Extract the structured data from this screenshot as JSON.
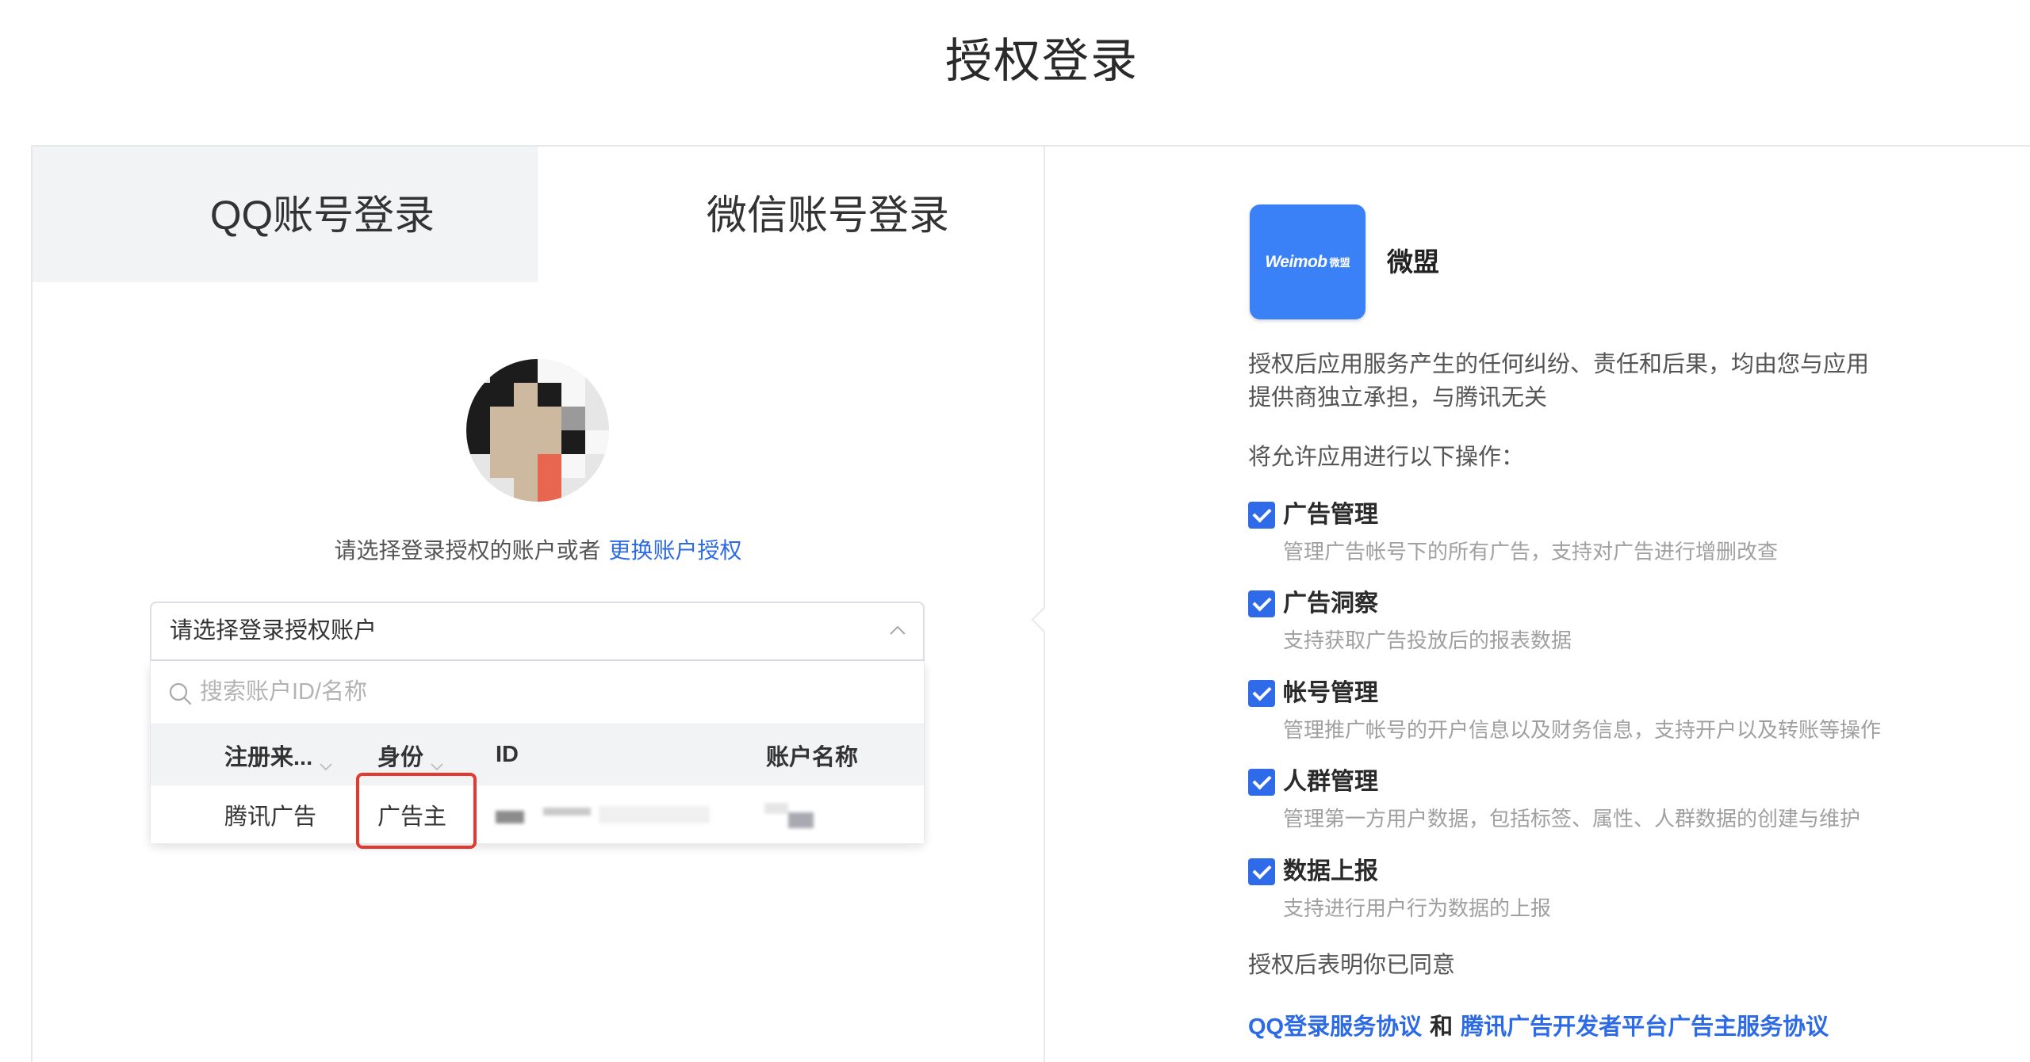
{
  "page": {
    "title": "授权登录"
  },
  "tabs": {
    "qq": {
      "label": "QQ账号登录",
      "active": true
    },
    "wechat": {
      "label": "微信账号登录",
      "active": false
    }
  },
  "account": {
    "prompt": "请选择登录授权的账户或者",
    "switch_link": "更换账户授权",
    "select_placeholder": "请选择登录授权账户",
    "search_placeholder": "搜索账户ID/名称",
    "columns": [
      "注册来...",
      "身份",
      "ID",
      "账户名称"
    ],
    "rows": [
      {
        "source": "腾讯广告",
        "role": "广告主"
      }
    ]
  },
  "app": {
    "logo_text": "Weimob",
    "logo_cn": "微盟",
    "name": "微盟"
  },
  "disclaimer_lines": [
    "授权后应用服务产生的任何纠纷、责任和后果，均由您与应用",
    "提供商独立承担，与腾讯无关"
  ],
  "permissions_intro": "将允许应用进行以下操作：",
  "permissions": [
    {
      "label": "广告管理",
      "description": "管理广告帐号下的所有广告，支持对广告进行增删改查",
      "checked": true
    },
    {
      "label": "广告洞察",
      "description": "支持获取广告投放后的报表数据",
      "checked": true
    },
    {
      "label": "帐号管理",
      "description": "管理推广帐号的开户信息以及财务信息，支持开户以及转账等操作",
      "checked": true
    },
    {
      "label": "人群管理",
      "description": "管理第一方用户数据，包括标签、属性、人群数据的创建与维护",
      "checked": true
    },
    {
      "label": "数据上报",
      "description": "支持进行用户行为数据的上报",
      "checked": true
    }
  ],
  "consent": {
    "intro": "授权后表明你已同意",
    "qq_agreement": "QQ登录服务协议",
    "joiner": "和",
    "tencent_agreement": "腾讯广告开发者平台广告主服务协议"
  },
  "icons": {
    "search": "search-icon",
    "select_toggle": "chevron-up-icon",
    "column_filter": "chevron-down-icon",
    "permission_checkbox": "check-icon"
  },
  "colors": {
    "link": "#2d6ae6",
    "checkbox": "#2f6be8",
    "logo_bg": "#3a80f6",
    "highlight": "#e4392f",
    "tab_active_bg": "#f2f3f5",
    "border": "#e6e8eb",
    "text": "#2b2b2b",
    "muted": "#a0a0a0"
  }
}
